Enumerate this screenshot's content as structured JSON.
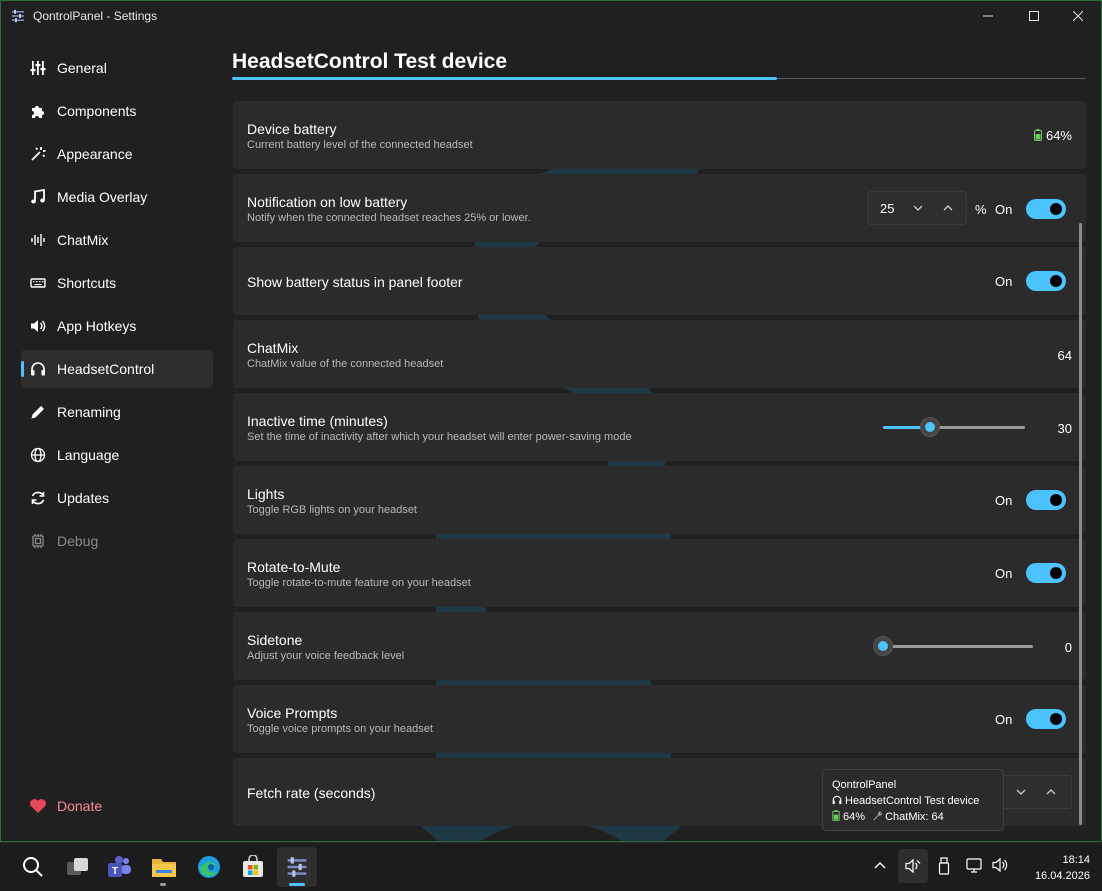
{
  "window": {
    "title": "QontrolPanel - Settings"
  },
  "sidebar": {
    "items": [
      {
        "label": "General",
        "icon": "sliders-icon"
      },
      {
        "label": "Components",
        "icon": "puzzle-icon"
      },
      {
        "label": "Appearance",
        "icon": "magic-wand-icon"
      },
      {
        "label": "Media Overlay",
        "icon": "music-note-icon"
      },
      {
        "label": "ChatMix",
        "icon": "waveform-icon"
      },
      {
        "label": "Shortcuts",
        "icon": "keyboard-icon"
      },
      {
        "label": "App Hotkeys",
        "icon": "speaker-icon"
      },
      {
        "label": "HeadsetControl",
        "icon": "headset-icon",
        "active": true
      },
      {
        "label": "Renaming",
        "icon": "pencil-icon"
      },
      {
        "label": "Language",
        "icon": "globe-icon"
      },
      {
        "label": "Updates",
        "icon": "refresh-icon"
      },
      {
        "label": "Debug",
        "icon": "chip-icon",
        "disabled": true
      }
    ],
    "donate": {
      "label": "Donate",
      "icon": "heart-icon",
      "color": "#e5475b"
    }
  },
  "page": {
    "title": "HeadsetControl Test device",
    "accent": "#4cc2ff"
  },
  "settings": {
    "battery": {
      "title": "Device battery",
      "desc": "Current battery level of the connected headset",
      "value": "64%"
    },
    "low_battery": {
      "title": "Notification on low battery",
      "desc": "Notify when the connected headset reaches 25% or lower.",
      "threshold": "25",
      "unit": "%",
      "toggle": "On"
    },
    "footer_status": {
      "title": "Show battery status in panel footer",
      "toggle": "On"
    },
    "chatmix": {
      "title": "ChatMix",
      "desc": "ChatMix value of the connected headset",
      "value": "64"
    },
    "inactive": {
      "title": "Inactive time (minutes)",
      "desc": "Set the time of inactivity after which your headset will enter power-saving mode",
      "value": "30",
      "level": 0.33
    },
    "lights": {
      "title": "Lights",
      "desc": "Toggle RGB lights on your headset",
      "toggle": "On"
    },
    "rotate_mute": {
      "title": "Rotate-to-Mute",
      "desc": "Toggle rotate-to-mute feature on your headset",
      "toggle": "On"
    },
    "sidetone": {
      "title": "Sidetone",
      "desc": "Adjust your voice feedback level",
      "value": "0",
      "level": 0
    },
    "voice_prompts": {
      "title": "Voice Prompts",
      "desc": "Toggle voice prompts on your headset",
      "toggle": "On"
    },
    "fetch_rate": {
      "title": "Fetch rate (seconds)"
    }
  },
  "tooltip": {
    "app": "QontrolPanel",
    "device": "HeadsetControl Test device",
    "battery": "64%",
    "chatmix": "ChatMix: 64"
  },
  "taskbar": {
    "apps": [
      "search-icon",
      "task-view-icon",
      "teams-icon",
      "file-explorer-icon",
      "edge-icon",
      "store-icon",
      "qontrolpanel-icon"
    ],
    "time": "18:14",
    "date": "16.04.2026"
  }
}
